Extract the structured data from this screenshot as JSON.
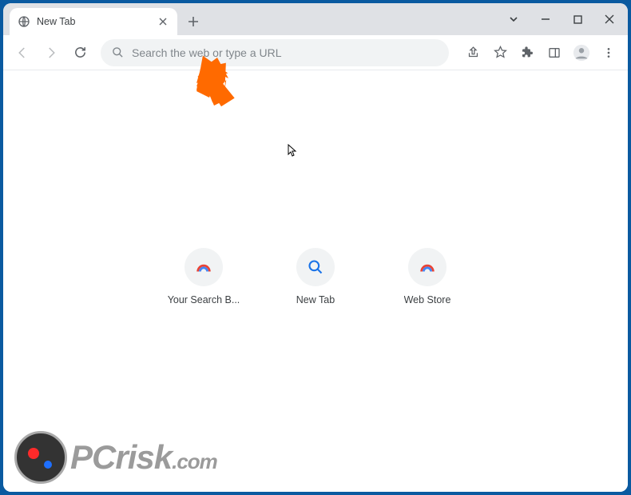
{
  "tab": {
    "title": "New Tab"
  },
  "omnibox": {
    "placeholder": "Search the web or type a URL"
  },
  "shortcuts": [
    {
      "label": "Your Search B...",
      "icon": "rainbow"
    },
    {
      "label": "New Tab",
      "icon": "search"
    },
    {
      "label": "Web Store",
      "icon": "rainbow"
    }
  ],
  "watermark": {
    "text1": "PC",
    "text2": "risk",
    "text3": ".com"
  }
}
